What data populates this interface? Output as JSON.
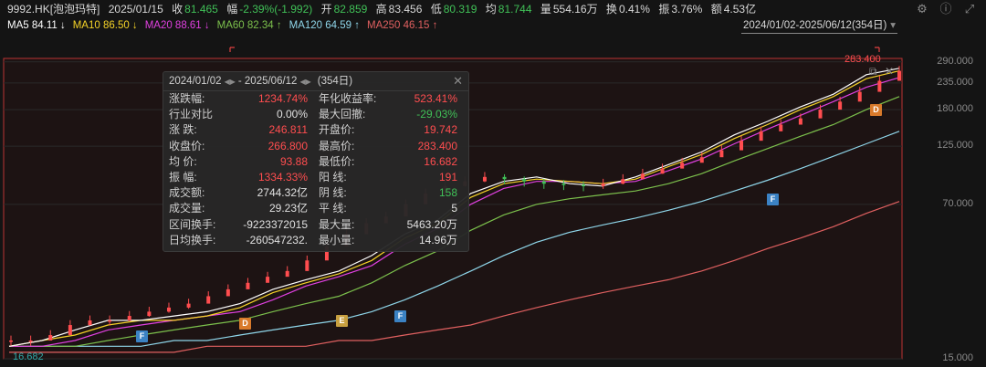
{
  "header": {
    "symbol": "9992.HK[泡泡玛特]",
    "date": "2025/01/15",
    "close_label": "收",
    "close": "81.465",
    "change_label": "幅",
    "change": "-2.39%(-1.992)",
    "open_label": "开",
    "open": "82.859",
    "high_label": "高",
    "high": "83.456",
    "low_label": "低",
    "low": "80.319",
    "avg_label": "均",
    "avg": "81.744",
    "vol_label": "量",
    "vol": "554.16万",
    "turnover_label": "换",
    "turnover": "0.41%",
    "amp_label": "振",
    "amp": "3.76%",
    "amount_label": "额",
    "amount": "4.53亿"
  },
  "ma": [
    {
      "label": "MA5 84.11",
      "arrow": "↓",
      "color": "#ffffff"
    },
    {
      "label": "MA10 86.50",
      "arrow": "↓",
      "color": "#f5d327"
    },
    {
      "label": "MA20 88.61",
      "arrow": "↓",
      "color": "#e040e0"
    },
    {
      "label": "MA60 82.34",
      "arrow": "↑",
      "color": "#7cc04c"
    },
    {
      "label": "MA120 64.59",
      "arrow": "↑",
      "color": "#8fd6ea"
    },
    {
      "label": "MA250 46.15",
      "arrow": "↑",
      "color": "#e06060"
    }
  ],
  "range_label": "2024/01/02-2025/06/12(354日)",
  "popup": {
    "start": "2024/01/02",
    "sep": "- 2025/06/12",
    "days": "(354日)",
    "rows": [
      {
        "l1": "涨跌幅:",
        "v1": "1234.74%",
        "c1": "#ff4d4f",
        "l2": "年化收益率:",
        "v2": "523.41%",
        "c2": "#ff4d4f"
      },
      {
        "l1": "行业对比",
        "v1": "0.00%",
        "c1": "#e0e0e0",
        "l2": "最大回撤:",
        "v2": "-29.03%",
        "c2": "#40c057"
      },
      {
        "l1": "涨  跌:",
        "v1": "246.811",
        "c1": "#ff4d4f",
        "l2": "开盘价:",
        "v2": "19.742",
        "c2": "#ff4d4f"
      },
      {
        "l1": "收盘价:",
        "v1": "266.800",
        "c1": "#ff4d4f",
        "l2": "最高价:",
        "v2": "283.400",
        "c2": "#ff4d4f"
      },
      {
        "l1": "均  价:",
        "v1": "93.88",
        "c1": "#ff4d4f",
        "l2": "最低价:",
        "v2": "16.682",
        "c2": "#ff4d4f"
      },
      {
        "l1": "振  幅:",
        "v1": "1334.33%",
        "c1": "#ff4d4f",
        "l2": "阳  线:",
        "v2": "191",
        "c2": "#ff4d4f"
      },
      {
        "l1": "成交额:",
        "v1": "2744.32亿",
        "c1": "#e0e0e0",
        "l2": "阴  线:",
        "v2": "158",
        "c2": "#40c057"
      },
      {
        "l1": "成交量:",
        "v1": "29.23亿",
        "c1": "#e0e0e0",
        "l2": "平  线:",
        "v2": "5",
        "c2": "#e0e0e0"
      },
      {
        "l1": "区间换手:",
        "v1": "-9223372015",
        "c1": "#e0e0e0",
        "l2": "最大量:",
        "v2": "5463.20万",
        "c2": "#e0e0e0"
      },
      {
        "l1": "日均换手:",
        "v1": "-260547232.",
        "c1": "#e0e0e0",
        "l2": "最小量:",
        "v2": "14.96万",
        "c2": "#e0e0e0"
      }
    ]
  },
  "markers": [
    {
      "label": "F",
      "kind": "f"
    },
    {
      "label": "D",
      "kind": "d"
    },
    {
      "label": "E",
      "kind": "e"
    },
    {
      "label": "F",
      "kind": "f"
    },
    {
      "label": "F",
      "kind": "f"
    },
    {
      "label": "D",
      "kind": "d"
    }
  ],
  "chart_data": {
    "type": "line",
    "subtype": "candlestick",
    "scale": "log",
    "ylim": [
      15,
      300
    ],
    "yticks": [
      "290.000",
      "235.000",
      "180.000",
      "125.000",
      "70.000",
      "15.000"
    ],
    "ytick_values": [
      290,
      235,
      180,
      125,
      70,
      15
    ],
    "low_label": "16.682",
    "high_label": "283.400",
    "x_start": "2024/01/02",
    "x_end": "2025/06/12",
    "series": [
      {
        "name": "MA5",
        "color": "#ffffff",
        "values": [
          17,
          18,
          20,
          22,
          22,
          23,
          24,
          26,
          30,
          33,
          36,
          42,
          52,
          60,
          78,
          88,
          92,
          86,
          84,
          92,
          104,
          118,
          140,
          160,
          185,
          210,
          255,
          272
        ]
      },
      {
        "name": "MA10",
        "color": "#f5d327",
        "values": [
          17,
          18,
          19,
          21,
          22,
          22,
          23,
          25,
          29,
          32,
          35,
          40,
          50,
          58,
          75,
          86,
          90,
          88,
          86,
          90,
          102,
          115,
          135,
          155,
          180,
          205,
          245,
          265
        ]
      },
      {
        "name": "MA20",
        "color": "#e040e0",
        "values": [
          17,
          17,
          18,
          20,
          21,
          22,
          23,
          24,
          27,
          31,
          34,
          38,
          47,
          55,
          70,
          82,
          88,
          88,
          86,
          88,
          98,
          110,
          128,
          148,
          170,
          195,
          225,
          248
        ]
      },
      {
        "name": "MA60",
        "color": "#7cc04c",
        "values": [
          17,
          17,
          17,
          18,
          19,
          20,
          21,
          22,
          24,
          26,
          28,
          32,
          38,
          44,
          54,
          63,
          70,
          74,
          77,
          80,
          86,
          95,
          108,
          122,
          138,
          155,
          180,
          205
        ]
      },
      {
        "name": "MA120",
        "color": "#8fd6ea",
        "values": [
          17,
          17,
          17,
          17,
          17,
          18,
          18,
          19,
          20,
          21,
          22,
          24,
          27,
          31,
          36,
          42,
          48,
          53,
          57,
          61,
          66,
          72,
          80,
          89,
          100,
          113,
          128,
          145
        ]
      },
      {
        "name": "MA250",
        "color": "#e06060",
        "values": [
          16,
          16,
          16,
          16,
          16,
          16,
          17,
          17,
          17,
          17,
          18,
          18,
          19,
          20,
          21,
          23,
          25,
          27,
          29,
          31,
          33,
          36,
          40,
          45,
          50,
          56,
          64,
          72
        ]
      }
    ],
    "candles": [
      18,
      18,
      19,
      21,
      22,
      22,
      23,
      24,
      25,
      26,
      28,
      30,
      32,
      34,
      36,
      40,
      46,
      52,
      58,
      62,
      70,
      78,
      84,
      88,
      92,
      90,
      88,
      86,
      85,
      84,
      86,
      90,
      95,
      100,
      106,
      112,
      120,
      132,
      145,
      155,
      165,
      180,
      195,
      215,
      240,
      265
    ]
  }
}
